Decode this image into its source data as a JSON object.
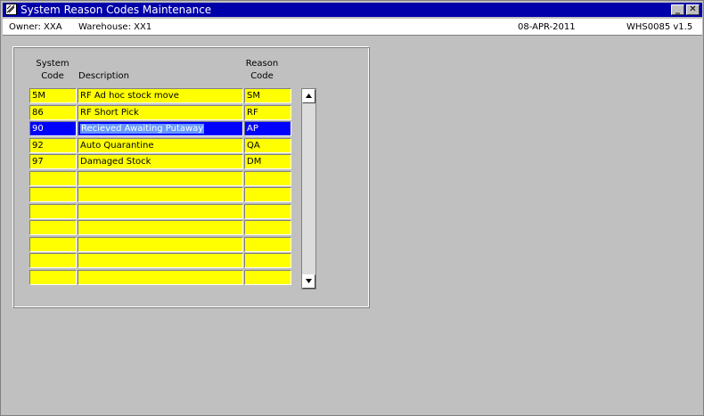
{
  "window": {
    "title": "System Reason Codes Maintenance",
    "min_label": "_",
    "close_label": "✕"
  },
  "status": {
    "owner": "Owner:  XXA",
    "warehouse": "Warehouse:  XX1",
    "date": "08-APR-2011",
    "version": "WHS0085  v1.5"
  },
  "table": {
    "headers": {
      "system_code": "System Code",
      "description": "Description",
      "reason_code": "Reason Code"
    },
    "rows": [
      {
        "system_code": "5M",
        "description": "RF Ad hoc stock move",
        "reason_code": "SM"
      },
      {
        "system_code": "86",
        "description": "RF Short Pick",
        "reason_code": "RF"
      },
      {
        "system_code": "90",
        "description": "Recieved Awaiting Putaway",
        "reason_code": "AP",
        "selected": true
      },
      {
        "system_code": "92",
        "description": "Auto Quarantine",
        "reason_code": "QA"
      },
      {
        "system_code": "97",
        "description": "Damaged Stock",
        "reason_code": "DM"
      },
      {
        "system_code": "",
        "description": "",
        "reason_code": ""
      },
      {
        "system_code": "",
        "description": "",
        "reason_code": ""
      },
      {
        "system_code": "",
        "description": "",
        "reason_code": ""
      },
      {
        "system_code": "",
        "description": "",
        "reason_code": ""
      },
      {
        "system_code": "",
        "description": "",
        "reason_code": ""
      },
      {
        "system_code": "",
        "description": "",
        "reason_code": ""
      },
      {
        "system_code": "",
        "description": "",
        "reason_code": ""
      }
    ]
  },
  "colors": {
    "titlebar": "#0000aa",
    "field": "#ffff00",
    "selected_row": "#0000ff",
    "background": "#c0c0c0"
  },
  "icons": {
    "app": "oracle-forms-icon",
    "scroll_up": "arrow-up-icon",
    "scroll_down": "arrow-down-icon"
  }
}
